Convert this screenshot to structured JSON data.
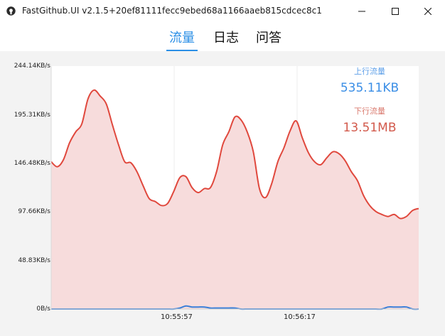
{
  "window": {
    "title": "FastGithub.UI v2.1.5+20ef81111fecc9ebed68a1166aaeb815cdcec8c1",
    "controls": {
      "minimize": "minimize-icon",
      "maximize": "maximize-icon",
      "close": "close-icon"
    }
  },
  "tabs": [
    {
      "label": "流量",
      "active": true
    },
    {
      "label": "日志",
      "active": false
    },
    {
      "label": "问答",
      "active": false
    }
  ],
  "legend": {
    "upload": {
      "title": "上行流量",
      "value": "535.11KB",
      "color": "#3a8ee6"
    },
    "download": {
      "title": "下行流量",
      "value": "13.51MB",
      "color": "#e05c4c"
    }
  },
  "chart_data": {
    "type": "area",
    "y_tick_labels": [
      "244.14KB/s",
      "195.31KB/s",
      "146.48KB/s",
      "97.66KB/s",
      "48.83KB/s",
      "0B/s"
    ],
    "x_tick_labels": [
      "10:55:57",
      "10:56:17"
    ],
    "ylim": [
      0,
      244.14
    ],
    "grid": true,
    "legend_position": "top-right",
    "series": [
      {
        "name": "下行流量",
        "color": "#e0483d",
        "fill": "#f7dcdc",
        "values": [
          148,
          143,
          150,
          167,
          178,
          186,
          211,
          220,
          214,
          206,
          185,
          165,
          148,
          147,
          138,
          124,
          111,
          108,
          104,
          106,
          118,
          132,
          133,
          122,
          117,
          121,
          122,
          138,
          165,
          178,
          193,
          190,
          178,
          158,
          121,
          112,
          126,
          148,
          162,
          179,
          189,
          172,
          157,
          148,
          145,
          152,
          158,
          156,
          149,
          138,
          129,
          114,
          104,
          98,
          95,
          93,
          95,
          91,
          93,
          99,
          101
        ]
      },
      {
        "name": "上行流量",
        "color": "#3a7fd9",
        "values": [
          0,
          0,
          0,
          0,
          0,
          0,
          0,
          0,
          0,
          0,
          0,
          0,
          0,
          0,
          0,
          0,
          0,
          0,
          0,
          0,
          0,
          1,
          3,
          2,
          2,
          2,
          1,
          1,
          1,
          1,
          1,
          0,
          0,
          0,
          0,
          0,
          0,
          0,
          0,
          0,
          0,
          0,
          0,
          0,
          0,
          0,
          0,
          0,
          0,
          0,
          0,
          0,
          0,
          0,
          0,
          2,
          2,
          2,
          2,
          0,
          0
        ]
      }
    ]
  }
}
